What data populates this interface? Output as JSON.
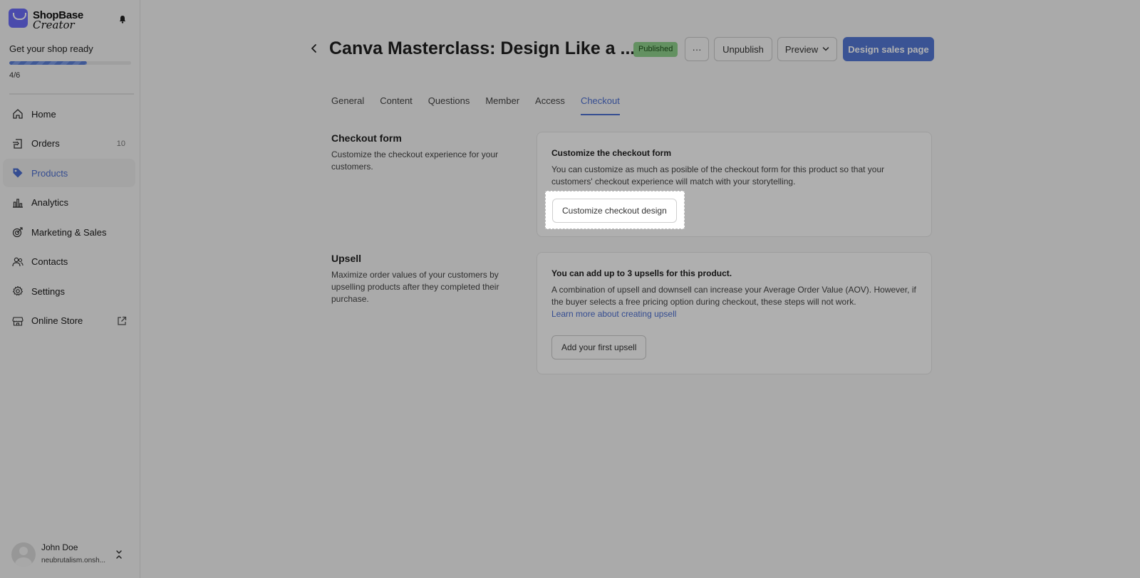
{
  "app": {
    "logo_line1": "ShopBase",
    "logo_line2": "Creator"
  },
  "sidebar": {
    "setup_title": "Get your shop ready",
    "setup_progress": 0.64,
    "setup_count": "4/6",
    "items": [
      {
        "label": "Home",
        "icon": "home-icon",
        "badge": ""
      },
      {
        "label": "Orders",
        "icon": "orders-icon",
        "badge": "10"
      },
      {
        "label": "Products",
        "icon": "tag-icon",
        "badge": "",
        "active": true
      },
      {
        "label": "Analytics",
        "icon": "analytics-icon",
        "badge": ""
      },
      {
        "label": "Marketing & Sales",
        "icon": "target-icon",
        "badge": ""
      },
      {
        "label": "Contacts",
        "icon": "contacts-icon",
        "badge": ""
      },
      {
        "label": "Settings",
        "icon": "gear-icon",
        "badge": ""
      },
      {
        "label": "Online Store",
        "icon": "store-icon",
        "badge": ""
      }
    ],
    "user": {
      "name": "John Doe",
      "shop": "neubrutalism.onsh..."
    }
  },
  "header": {
    "title": "Canva Masterclass: Design Like a ...",
    "status": "Published",
    "more_label": "···",
    "unpublish_label": "Unpublish",
    "preview_label": "Preview",
    "design_label": "Design sales page"
  },
  "tabs": [
    {
      "label": "General"
    },
    {
      "label": "Content"
    },
    {
      "label": "Questions"
    },
    {
      "label": "Member"
    },
    {
      "label": "Access"
    },
    {
      "label": "Checkout",
      "active": true
    }
  ],
  "checkout_section": {
    "title": "Checkout form",
    "description": "Customize the checkout experience for your customers.",
    "card_title": "Customize the checkout form",
    "card_text": "You can customize as much as posible of the checkout form for this product so that your customers' checkout experience will match with your storytelling.",
    "button_label": "Customize checkout design"
  },
  "upsell_section": {
    "title": "Upsell",
    "description": "Maximize order values of your customers by upselling products after they completed their purchase.",
    "card_title": "You can add up to 3 upsells for this product.",
    "card_text": "A combination of upsell and downsell can increase your Average Order Value (AOV). However, if the buyer selects a free pricing option during checkout, these steps will not work.",
    "link_label": "Learn more about creating upsell",
    "button_label": "Add your first upsell"
  },
  "colors": {
    "accent": "#4d6fd0",
    "primary_button": "#5478d4",
    "published_badge": "#8fd08b"
  }
}
